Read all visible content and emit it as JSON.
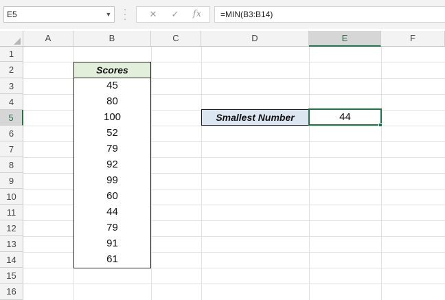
{
  "formula_bar": {
    "name_box": "E5",
    "cancel_icon": "✕",
    "enter_icon": "✓",
    "fx_icon": "fx",
    "formula": "=MIN(B3:B14)"
  },
  "columns": [
    "A",
    "B",
    "C",
    "D",
    "E",
    "F"
  ],
  "rows": [
    "1",
    "2",
    "3",
    "4",
    "5",
    "6",
    "7",
    "8",
    "9",
    "10",
    "11",
    "12",
    "13",
    "14",
    "15",
    "16"
  ],
  "table": {
    "header": "Scores",
    "values": [
      "45",
      "80",
      "100",
      "52",
      "79",
      "92",
      "99",
      "60",
      "44",
      "79",
      "91",
      "61"
    ]
  },
  "result": {
    "label": "Smallest Number",
    "value": "44"
  },
  "colors": {
    "accent": "#217346",
    "header_fill": "#e2efda",
    "label_fill": "#dce6f1"
  }
}
